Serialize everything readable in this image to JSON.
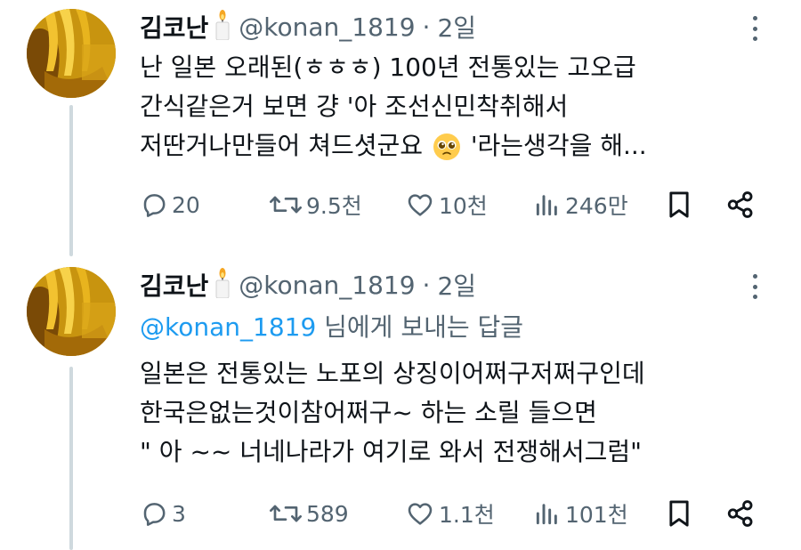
{
  "colors": {
    "text": "#0f1419",
    "muted": "#536471",
    "link": "#1d9bf0",
    "thread_line": "#cfd9de"
  },
  "tweets": [
    {
      "author_name": "김코난",
      "handle": "@konan_1819",
      "separator": "·",
      "time": "2일",
      "lines": [
        "난 일본 오래된(ㅎㅎㅎ) 100년 전통있는 고오급",
        "간식같은거 보면 걍 '아 조선신민착취해서",
        "저딴거나만들어 쳐드셧군요",
        "'라는생각을 해..."
      ],
      "emoji": "pleading-face-emoji",
      "counts": {
        "replies": "20",
        "retweets": "9.5천",
        "likes": "10천",
        "views": "246만"
      }
    },
    {
      "author_name": "김코난",
      "handle": "@konan_1819",
      "separator": "·",
      "time": "2일",
      "reply_mention": "@konan_1819",
      "reply_suffix": " 님에게 보내는 답글",
      "lines": [
        "일본은 전통있는 노포의 상징이어쩌구저쩌구인데",
        "한국은없는것이참어쩌구~ 하는 소릴 들으면",
        "\" 아 ~~ 너네나라가 여기로 와서 전쟁해서그럼\""
      ],
      "counts": {
        "replies": "3",
        "retweets": "589",
        "likes": "1.1천",
        "views": "101천"
      }
    }
  ],
  "icons": {
    "reply": "reply-icon",
    "retweet": "retweet-icon",
    "like": "heart-icon",
    "views": "views-icon",
    "bookmark": "bookmark-icon",
    "share": "share-icon",
    "more": "more-options-icon",
    "candle": "candle-emoji-icon"
  }
}
